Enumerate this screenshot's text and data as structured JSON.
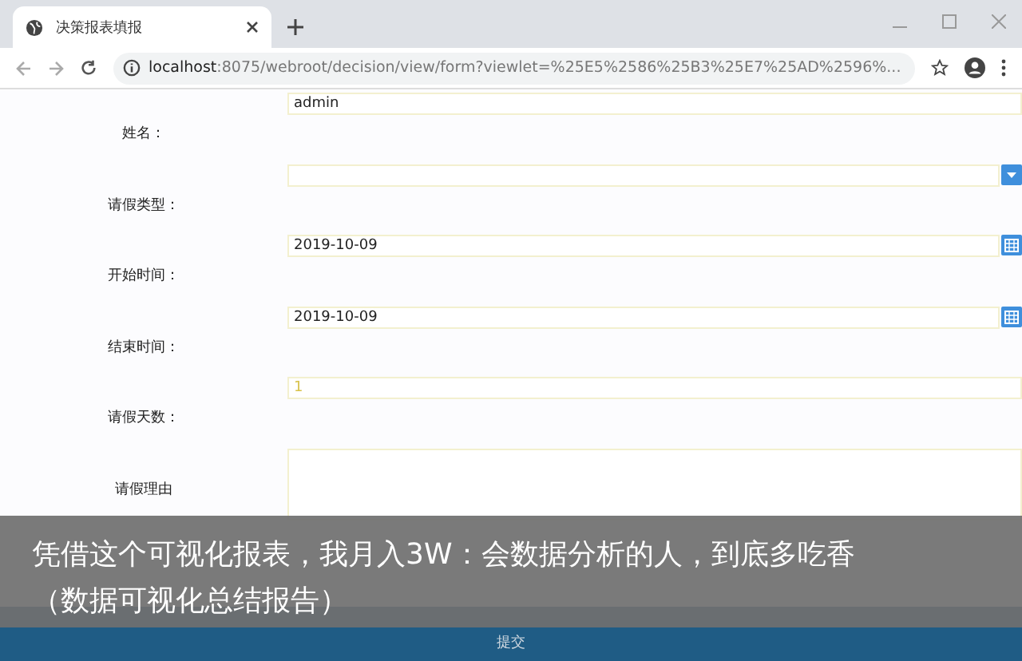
{
  "browser": {
    "tab_title": "决策报表填报",
    "url_host": "localhost",
    "url_rest": ":8075/webroot/decision/view/form?viewlet=%25E5%2586%25B3%25E7%25AD%2596%..."
  },
  "form": {
    "fields": [
      {
        "label": "姓名：",
        "kind": "text",
        "value": "admin"
      },
      {
        "label": "请假类型：",
        "kind": "dropdown"
      },
      {
        "label": "开始时间：",
        "kind": "date",
        "value": "2019-10-09"
      },
      {
        "label": "结束时间：",
        "kind": "date",
        "value": "2019-10-09"
      },
      {
        "label": "请假天数：",
        "kind": "number",
        "value": "1"
      },
      {
        "label": "请假理由",
        "kind": "textarea"
      }
    ],
    "submit": "提交"
  },
  "caption": "凭借这个可视化报表，我月入3W：会数据分析的人，到底多吃香（数据可视化总结报告）"
}
